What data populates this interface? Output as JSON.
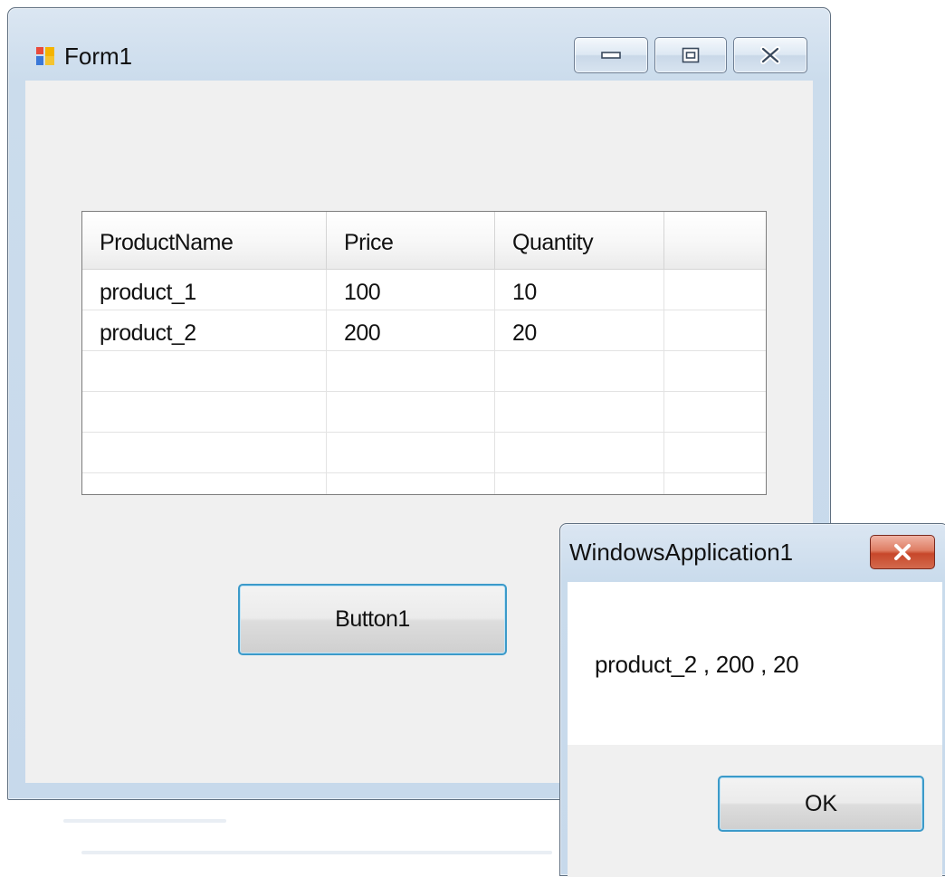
{
  "form": {
    "title": "Form1",
    "controls": [
      "minimize-icon",
      "maximize-icon",
      "close-icon"
    ]
  },
  "grid": {
    "columns": [
      "ProductName",
      "Price",
      "Quantity",
      ""
    ],
    "rows": [
      [
        "product_1",
        "100",
        "10",
        ""
      ],
      [
        "product_2",
        "200",
        "20",
        ""
      ],
      [
        "",
        "",
        "",
        ""
      ],
      [
        "",
        "",
        "",
        ""
      ],
      [
        "",
        "",
        "",
        ""
      ]
    ]
  },
  "button1": {
    "label": "Button1"
  },
  "message_box": {
    "title": "WindowsApplication1",
    "message": "product_2 , 200 , 20",
    "ok_label": "OK"
  },
  "colors": {
    "accent_border": "#3c9ac9",
    "close_red": "#c7472a",
    "client_bg": "#f0f0f0"
  }
}
